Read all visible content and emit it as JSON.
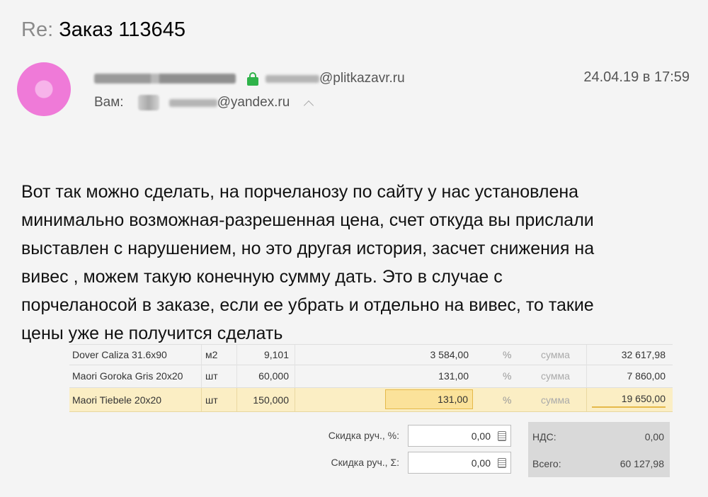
{
  "email": {
    "subject_prefix": "Re:",
    "subject": "Заказ 113645",
    "from": {
      "domain": "@plitkazavr.ru"
    },
    "date": "24.04.19 в 17:59",
    "to": {
      "label": "Вам:",
      "domain": "@yandex.ru"
    },
    "body_lines": [
      "Вот так можно сделать, на порчеланозу по сайту у нас установлена",
      "минимально возможная-разрешенная цена, счет откуда вы прислали",
      "выставлен с нарушением, но это другая история, засчет снижения на",
      "вивес , можем такую конечную сумму дать. Это в случае с",
      "порчеланосой в заказе, если ее убрать и отдельно на вивес, то такие",
      "цены уже не получится сделать"
    ]
  },
  "order": {
    "rows": [
      {
        "name": "Dover Caliza 31.6x90",
        "unit": "м2",
        "qty": "9,101",
        "price": "3 584,00",
        "pct": "%",
        "sum_label": "сумма",
        "total": "32 617,98"
      },
      {
        "name": "Maori Goroka Gris 20x20",
        "unit": "шт",
        "qty": "60,000",
        "price": "131,00",
        "pct": "%",
        "sum_label": "сумма",
        "total": "7 860,00"
      },
      {
        "name": "Maori Tiebele 20x20",
        "unit": "шт",
        "qty": "150,000",
        "price": "131,00",
        "pct": "%",
        "sum_label": "сумма",
        "total": "19 650,00"
      }
    ],
    "discount_pct_label": "Скидка руч., %:",
    "discount_pct_value": "0,00",
    "discount_sum_label": "Скидка руч., Σ:",
    "discount_sum_value": "0,00",
    "vat_label": "НДС:",
    "vat_value": "0,00",
    "total_label": "Всего:",
    "total_value": "60 127,98"
  },
  "icons": {
    "lock": "lock-icon",
    "chevron": "chevron-up-icon",
    "calculator": "calculator-icon"
  },
  "colors": {
    "avatar": "#ef7ad8",
    "lock": "#2fb34a",
    "highlight_row": "#fbeec4",
    "highlight_cell": "#fbe29a"
  }
}
